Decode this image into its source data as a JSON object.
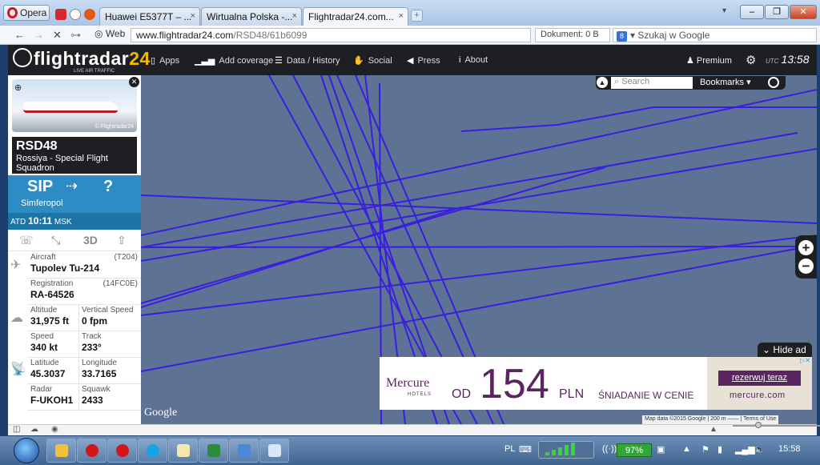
{
  "browser": {
    "opera_label": "Opera",
    "tabs": [
      {
        "label": "Huawei E5377T – ...",
        "close": "×"
      },
      {
        "label": "Wirtualna Polska -...",
        "close": "×"
      },
      {
        "label": "Flightradar24.com...",
        "close": "×"
      }
    ],
    "new_tab": "+",
    "nav_back": "←",
    "nav_forward": "→",
    "nav_stop": "✕",
    "nav_key": "⊶",
    "web_badge": "Web",
    "url_domain": "www.flightradar24.com",
    "url_path": "/RSD48/61b6099",
    "document_size": "Dokument:  0 B",
    "search_placeholder": "Szukaj w Google",
    "window_controls": {
      "minimize": "–",
      "maximize": "❐",
      "close": "✕"
    }
  },
  "header": {
    "logo_main": "flightradar",
    "logo_num": "24",
    "logo_sub": "LIVE AIR TRAFFIC",
    "menu": [
      {
        "label": "Apps",
        "icon": "phone-icon"
      },
      {
        "label": "Add coverage",
        "icon": "signal-icon"
      },
      {
        "label": "Data / History",
        "icon": "database-icon"
      },
      {
        "label": "Social",
        "icon": "thumbs-up-icon"
      },
      {
        "label": "Press",
        "icon": "megaphone-icon"
      },
      {
        "label": "About",
        "icon": "info-icon"
      }
    ],
    "premium": "Premium",
    "utc_label": "UTC",
    "utc_time": "13:58"
  },
  "map": {
    "search_placeholder": "Search",
    "bookmarks": "Bookmarks",
    "zoom_in": "+",
    "zoom_out": "−",
    "hide_ad": "Hide ad",
    "google": "Google",
    "attribution": "Map data ©2015 Google  |  200 m  ⎯⎯⎯⎯  |  Terms of Use"
  },
  "ad": {
    "brand": "Mercure",
    "hotels": "HOTELS",
    "od": "OD",
    "price": "154",
    "currency": "PLN",
    "tagline": "ŚNIADANIE W CENIE",
    "cta": "rezerwuj teraz",
    "site": "mercure.com",
    "adchoices": "▷✕"
  },
  "flight": {
    "photo_credit": "© Flightradar24",
    "callsign": "RSD48",
    "airline": "Rossiya - Special Flight Squadron",
    "from": "SIP",
    "to": "?",
    "from_city": "Simferopol",
    "atd_label": "ATD",
    "atd_time": "10:11",
    "atd_tz": "MSK",
    "tools": [
      "☏",
      "⤡",
      "3D",
      "⇪"
    ],
    "aircraft_label": "Aircraft",
    "aircraft_code": "(T204)",
    "aircraft_value": "Tupolev Tu-214",
    "registration_label": "Registration",
    "registration_code": "(14FC0E)",
    "registration_value": "RA-64526",
    "altitude_label": "Altitude",
    "altitude_value": "31,975 ft",
    "vspeed_label": "Vertical Speed",
    "vspeed_value": "0 fpm",
    "speed_label": "Speed",
    "speed_value": "340 kt",
    "track_label": "Track",
    "track_value": "233°",
    "lat_label": "Latitude",
    "lat_value": "45.3037",
    "lon_label": "Longitude",
    "lon_value": "33.7165",
    "radar_label": "Radar",
    "radar_value": "F-UKOH1",
    "squawk_label": "Squawk",
    "squawk_value": "2433"
  },
  "taskbar": {
    "lang": "PL",
    "battery": "97%",
    "time": "15:58"
  },
  "colors": {
    "flight_path": "#3a1ee0",
    "map_bg": "#5e7293",
    "header_bg": "#1e1f22",
    "route_bg": "#2c8cc3",
    "ad_brand": "#5a2660"
  }
}
